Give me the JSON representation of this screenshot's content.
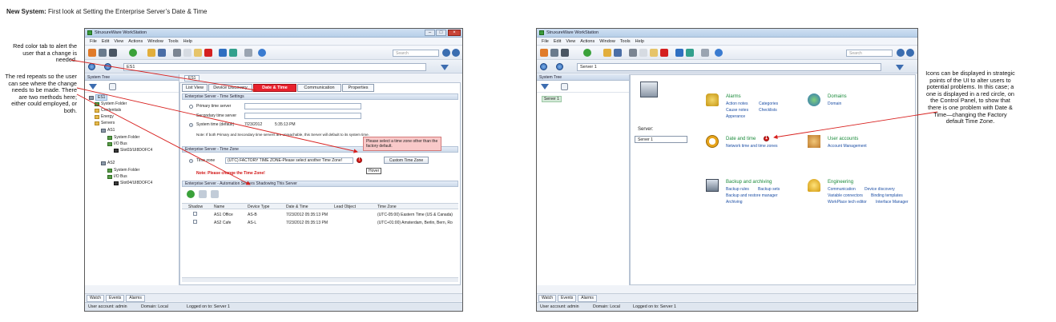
{
  "slide": {
    "title_bold": "New System:",
    "title_rest": " First look at Setting the Enterprise Server’s Date & Time"
  },
  "annotations": {
    "note1": "Red color tab to alert the user that a change is needed.",
    "note2": "The red repeats so the user can see where the change needs to be made. There are two methods here; either could employed, or both.",
    "note3": "Icons can be displayed in strategic points of the UI to alter users to potential problems. In this case; a one is displayed in a red circle, on the Control Panel, to show that there is one problem with Date & Time—changing the Factory default Time Zone."
  },
  "window": {
    "title": "StruxureWare WorkStation",
    "menu": [
      "File",
      "Edit",
      "View",
      "Actions",
      "Window",
      "Tools",
      "Help"
    ],
    "search_placeholder": "Search",
    "bottom_tabs": [
      "Watch",
      "Events",
      "Alarms"
    ],
    "status": {
      "user": "User account: admin",
      "domain": "Domain: Local",
      "logged": "Logged on to: Server 1"
    }
  },
  "left_window": {
    "address": "ES1",
    "tree_header": "System Tree",
    "tree": [
      {
        "label": "ES1"
      },
      {
        "label": "System Folder"
      },
      {
        "label": "Credentials"
      },
      {
        "label": "Energy"
      },
      {
        "label": "Servers"
      },
      {
        "label": "AS1"
      },
      {
        "label": "System Folder"
      },
      {
        "label": "I/O Bus"
      },
      {
        "label": "Slot03/UI8DOFC4"
      },
      {
        "label": "AS2"
      },
      {
        "label": "System Folder"
      },
      {
        "label": "I/O Bus"
      },
      {
        "label": "Slot04/UI8DOFC4"
      }
    ],
    "doc_tab": "ES1",
    "tabs": [
      "List View",
      "Device Discovery",
      "Date & Time",
      "Communication",
      "Properties"
    ],
    "time_settings": {
      "header": "Enterprise Server - Time Settings",
      "primary_label": "Primary time server",
      "secondary_label": "Secondary time server",
      "system_label": "System time (default)",
      "system_date": "7/23/2012",
      "system_time": "5:35:13 PM",
      "note": "Note: If both Primary and Secondary time servers are unreachable, this Server will default to its system time."
    },
    "time_zone": {
      "header": "Enterprise Server - Time Zone",
      "label": "Time zone",
      "value": "(UTC) FACTORY TIME ZONE-Please select another Time Zone!",
      "custom_button": "Custom Time Zone",
      "error_tip": "Please select a time zone other than the factory default.",
      "hover_tip": "Hover",
      "note": "Note: Please change the Time Zone!"
    },
    "shadowing": {
      "header": "Enterprise Server - Automation Servers Shadowing This Server",
      "columns": [
        "Shadow",
        "Name",
        "Device Type",
        "Date & Time",
        "Lead Object",
        "Time Zone"
      ],
      "rows": [
        {
          "name": "AS1 Office",
          "type": "AS-B",
          "datetime": "7/23/2012  05:35:13 PM",
          "lead": "",
          "tz": "(UTC-05:00) Eastern Time (US & Canada)"
        },
        {
          "name": "AS2 Cafe",
          "type": "AS-L",
          "datetime": "7/23/2012  05:35:13 PM",
          "lead": "",
          "tz": "(UTC+01:00) Amsterdam, Berlin, Bern, Ro"
        }
      ]
    }
  },
  "right_window": {
    "address": "Server 1",
    "tree_header": "System Tree",
    "tree_node": "Server 1",
    "server_label": "Server:",
    "server_value": "Server 1",
    "badge": "1",
    "groups": [
      {
        "title": "Alarms",
        "links": [
          "Action notes",
          "Categories",
          "Cause notes",
          "Checklists",
          "Apperance"
        ]
      },
      {
        "title": "Domains",
        "links": [
          "Domain"
        ]
      },
      {
        "title": "Date and time",
        "links": [
          "Network time and time zones"
        ]
      },
      {
        "title": "User accounts",
        "links": [
          "Account Management"
        ]
      },
      {
        "title": "Backup and archiving",
        "links": [
          "Backup rules",
          "Backup sets",
          "Backup and restore manager",
          "Archiving"
        ]
      },
      {
        "title": "Engineering",
        "links": [
          "Communication",
          "Device discovery",
          "Variable connectors",
          "Binding templates",
          "WorkPlace tech editor",
          "Interface Manager"
        ]
      }
    ]
  },
  "colors": {
    "alert_red": "#e8212d",
    "link_blue": "#1d4fa5",
    "heading_green": "#1a8a3a"
  }
}
